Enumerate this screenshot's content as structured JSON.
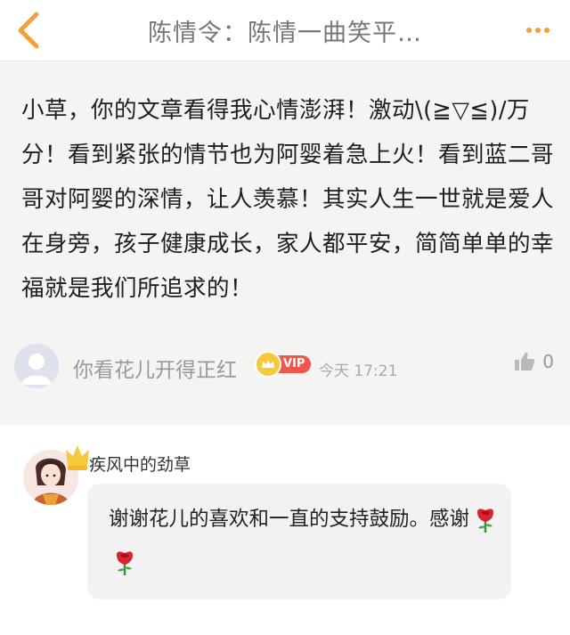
{
  "header": {
    "back_icon": "chevron-left-icon",
    "title": "陈情令：陈情一曲笑平…",
    "more_icon": "more-dots-icon",
    "accent_color": "#f2a03d"
  },
  "comment": {
    "text": "小草，你的文章看得我心情澎湃！激动\\(≧▽≦)/万分！看到紧张的情节也为阿婴着急上火！看到蓝二哥哥对阿婴的深情，让人羡慕！其实人生一世就是爱人在身旁，孩子健康成长，家人都平安，简简单单的幸福就是我们所追求的！",
    "user_name": "你看花儿开得正红",
    "vip_label": "VIP",
    "time": "今天 17:21",
    "like_icon": "thumbs-up-icon",
    "like_count": "0"
  },
  "reply": {
    "author": "疾风中的劲草",
    "text": "谢谢花儿的喜欢和一直的支持鼓励。感谢",
    "emoji_icons": [
      "rose-icon",
      "rose-icon"
    ]
  }
}
